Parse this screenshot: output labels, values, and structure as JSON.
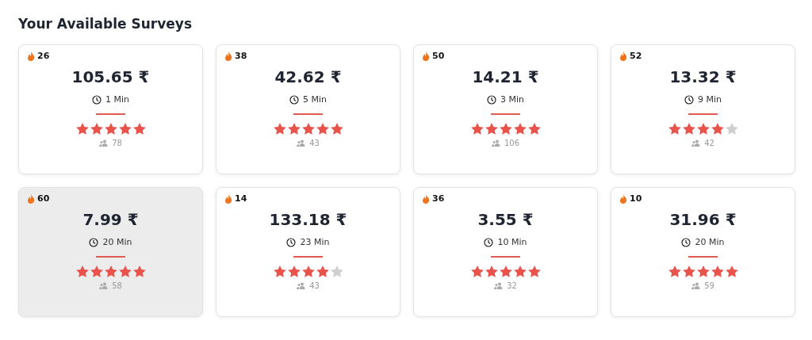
{
  "title": "Your Available Surveys",
  "surveys": [
    {
      "count": "26",
      "reward": "105.65 ₹",
      "duration": "1 Min",
      "stars": 5,
      "respondents": "78",
      "selected": false
    },
    {
      "count": "38",
      "reward": "42.62 ₹",
      "duration": "5 Min",
      "stars": 5,
      "respondents": "43",
      "selected": false
    },
    {
      "count": "50",
      "reward": "14.21 ₹",
      "duration": "3 Min",
      "stars": 5,
      "respondents": "106",
      "selected": false
    },
    {
      "count": "52",
      "reward": "13.32 ₹",
      "duration": "9 Min",
      "stars": 4,
      "respondents": "42",
      "selected": false
    },
    {
      "count": "60",
      "reward": "7.99 ₹",
      "duration": "20 Min",
      "stars": 5,
      "respondents": "58",
      "selected": true
    },
    {
      "count": "14",
      "reward": "133.18 ₹",
      "duration": "23 Min",
      "stars": 4,
      "respondents": "43",
      "selected": false
    },
    {
      "count": "36",
      "reward": "3.55 ₹",
      "duration": "10 Min",
      "stars": 5,
      "respondents": "32",
      "selected": false
    },
    {
      "count": "10",
      "reward": "31.96 ₹",
      "duration": "20 Min",
      "stars": 5,
      "respondents": "59",
      "selected": false
    }
  ]
}
